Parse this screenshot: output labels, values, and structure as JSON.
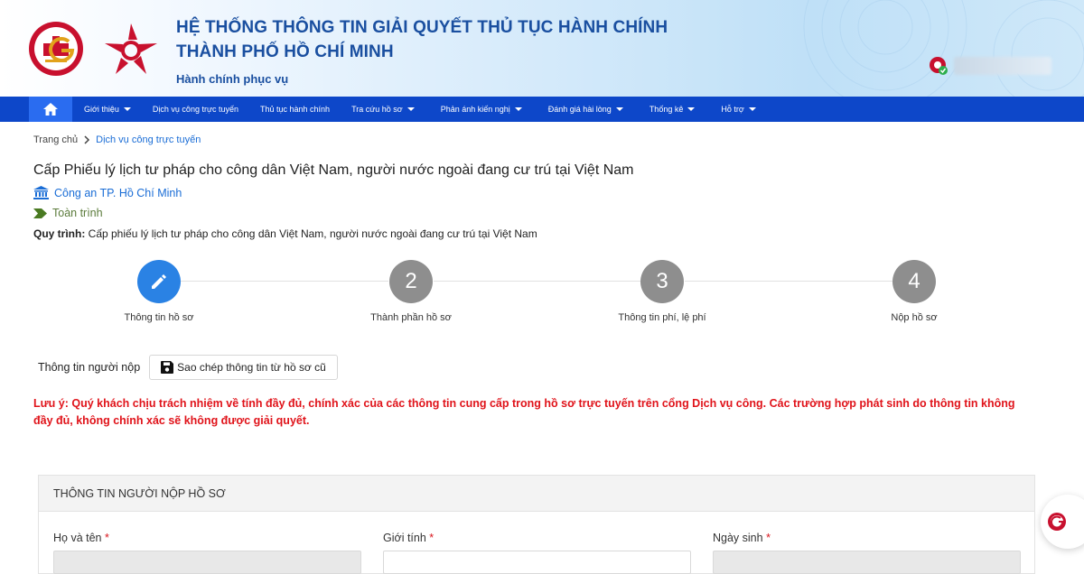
{
  "header": {
    "title_line1": "HỆ THỐNG THÔNG TIN GIẢI QUYẾT THỦ TỤC HÀNH CHÍNH",
    "title_line2": "THÀNH PHỐ HỒ CHÍ MINH",
    "subtitle": "Hành chính phục vụ",
    "brand_color": "#1a4fa0",
    "logo_left_icon": "city-emblem-icon",
    "logo_right_icon": "star-logo-icon"
  },
  "nav": {
    "background": "#0d47c9",
    "home_icon": "home-icon",
    "items": [
      {
        "label": "Giới thiệu",
        "has_dropdown": true
      },
      {
        "label": "Dịch vụ công trực tuyến",
        "has_dropdown": false
      },
      {
        "label": "Thủ tục hành chính",
        "has_dropdown": false
      },
      {
        "label": "Tra cứu hồ sơ",
        "has_dropdown": true
      },
      {
        "label": "Phản ánh kiến nghị",
        "has_dropdown": true
      },
      {
        "label": "Đánh giá hài lòng",
        "has_dropdown": true
      },
      {
        "label": "Thống kê",
        "has_dropdown": true
      },
      {
        "label": "Hỗ trợ",
        "has_dropdown": true
      }
    ]
  },
  "breadcrumb": {
    "home": "Trang chủ",
    "current": "Dịch vụ công trực tuyến"
  },
  "procedure": {
    "title": "Cấp Phiếu lý lịch tư pháp cho công dân Việt Nam, người nước ngoài đang cư trú tại Việt Nam",
    "agency": "Công an TP. Hồ Chí Minh",
    "level": "Toàn trình",
    "process_label": "Quy trình:",
    "process_value": " Cấp phiếu lý lịch tư pháp cho công dân Việt Nam, người nước ngoài đang cư trú tại Việt Nam"
  },
  "steps": [
    {
      "number": "",
      "label": "Thông tin hồ sơ",
      "active": true,
      "icon": "pencil-icon"
    },
    {
      "number": "2",
      "label": "Thành phần hồ sơ",
      "active": false
    },
    {
      "number": "3",
      "label": "Thông tin phí, lệ phí",
      "active": false
    },
    {
      "number": "4",
      "label": "Nộp hồ sơ",
      "active": false
    }
  ],
  "submitter": {
    "label": "Thông tin người nộp",
    "copy_button": "Sao chép thông tin từ hồ sơ cũ"
  },
  "warning": "Lưu ý: Quý khách chịu trách nhiệm về tính đầy đủ, chính xác của các thông tin cung cấp trong hồ sơ trực tuyến trên cổng Dịch vụ công. Các trường hợp phát sinh do thông tin không đầy đủ, không chính xác sẽ không được giải quyết.",
  "form": {
    "section_title": "THÔNG TIN NGƯỜI NỘP HỒ SƠ",
    "fields": [
      {
        "label": "Họ và tên",
        "required": "*"
      },
      {
        "label": "Giới tính",
        "required": "*"
      },
      {
        "label": "Ngày sinh",
        "required": "*"
      }
    ]
  }
}
